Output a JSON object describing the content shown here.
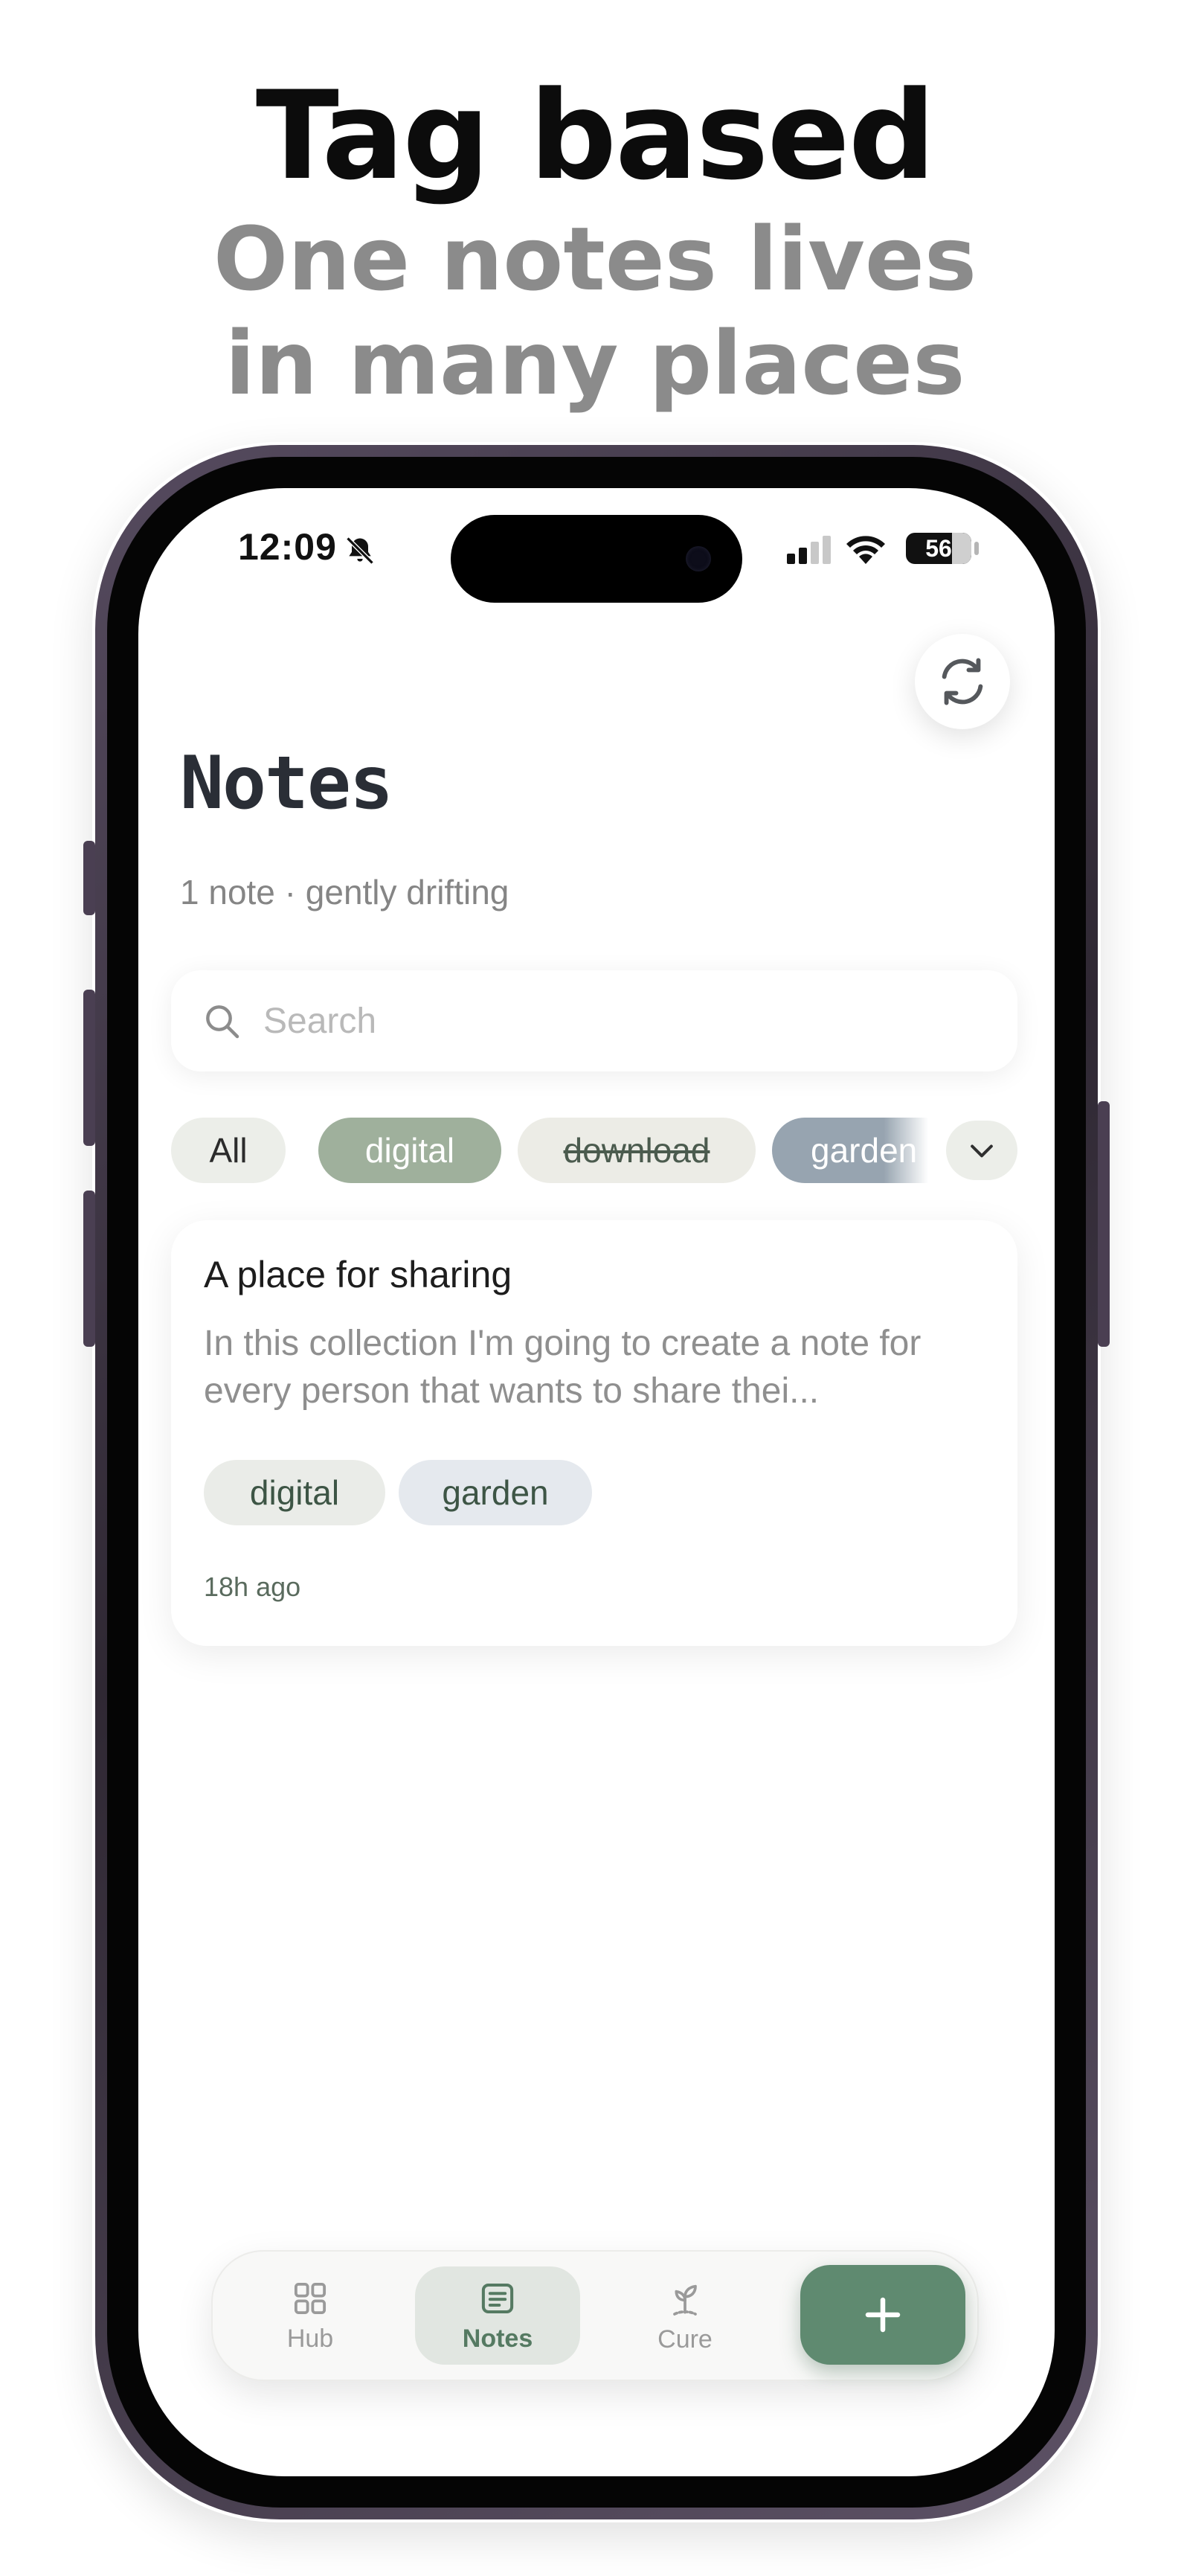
{
  "headline": {
    "title": "Tag based",
    "subtitle_line1": "One notes lives",
    "subtitle_line2": "in many places"
  },
  "status_bar": {
    "time": "12:09",
    "battery": "56",
    "icons": [
      "bell-slash-icon",
      "cellular-signal-icon",
      "wifi-icon",
      "battery-icon"
    ]
  },
  "header": {
    "title": "Notes",
    "subtitle": "1 note · gently drifting",
    "sync_icon": "refresh-icon"
  },
  "search": {
    "placeholder": "Search",
    "value": ""
  },
  "filters": {
    "chips": [
      {
        "label": "All"
      },
      {
        "label": "digital"
      },
      {
        "label": "download"
      },
      {
        "label": "garden"
      }
    ],
    "expand_icon": "chevron-down-icon"
  },
  "notes": [
    {
      "title": "A place for sharing",
      "excerpt": "In this collection I'm going to create a note for every person that wants to share thei...",
      "tags": [
        "digital",
        "garden"
      ],
      "time": "18h ago"
    }
  ],
  "tabbar": {
    "tabs": [
      {
        "label": "Hub",
        "icon": "grid-icon"
      },
      {
        "label": "Notes",
        "icon": "note-icon"
      },
      {
        "label": "Cure",
        "icon": "sprout-icon"
      }
    ],
    "add_icon": "plus-icon"
  },
  "colors": {
    "accent": "#5f8a70",
    "chip_digital": "#9fb09c",
    "chip_garden": "#97a4b0"
  }
}
